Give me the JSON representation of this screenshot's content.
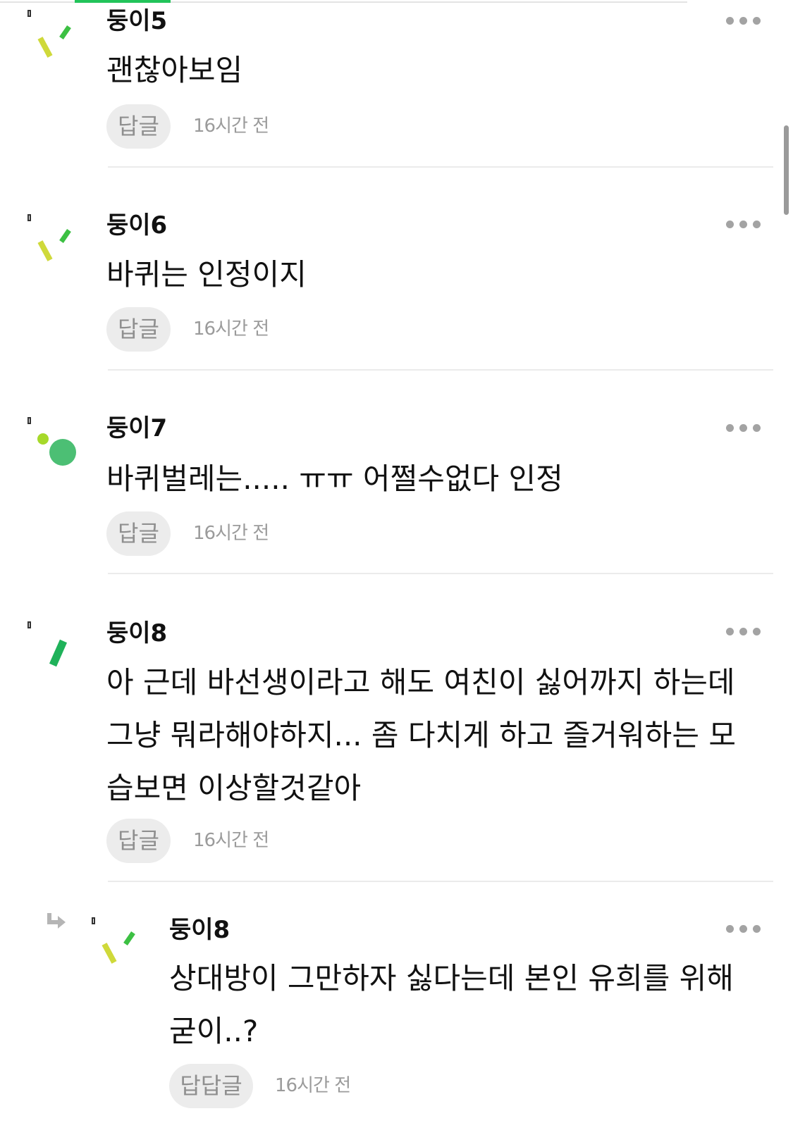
{
  "comments": [
    {
      "author": "둥이5",
      "body": [
        "괜찮아보임"
      ],
      "reply_label": "답글",
      "time": "16시간 전"
    },
    {
      "author": "둥이6",
      "body": [
        "바퀴는 인정이지"
      ],
      "reply_label": "답글",
      "time": "16시간 전"
    },
    {
      "author": "둥이7",
      "body": [
        "바퀴벌레는..... ㅠㅠ 어쩔수없다 인정"
      ],
      "reply_label": "답글",
      "time": "16시간 전"
    },
    {
      "author": "둥이8",
      "body": [
        "아 근데 바선생이라고 해도 여친이 싫어까지 하는데",
        "그냥 뭐라해야하지... 좀 다치게 하고 즐거워하는 모",
        "습보면 이상할것같아"
      ],
      "reply_label": "답글",
      "time": "16시간 전"
    }
  ],
  "reply": {
    "author": "둥이8",
    "body": [
      "상대방이 그만하자 싫다는데 본인 유희를 위해",
      "굳이..?"
    ],
    "reply_label": "답답글",
    "time": "16시간 전"
  },
  "colors": {
    "accent": "#22c45a",
    "avatar_green": "#3cb371",
    "avatar_lime": "#c8d63a",
    "muted": "#9b9b9b"
  },
  "icons": {
    "more": "more-dots-icon",
    "reply_arrow": "reply-arrow-icon"
  }
}
